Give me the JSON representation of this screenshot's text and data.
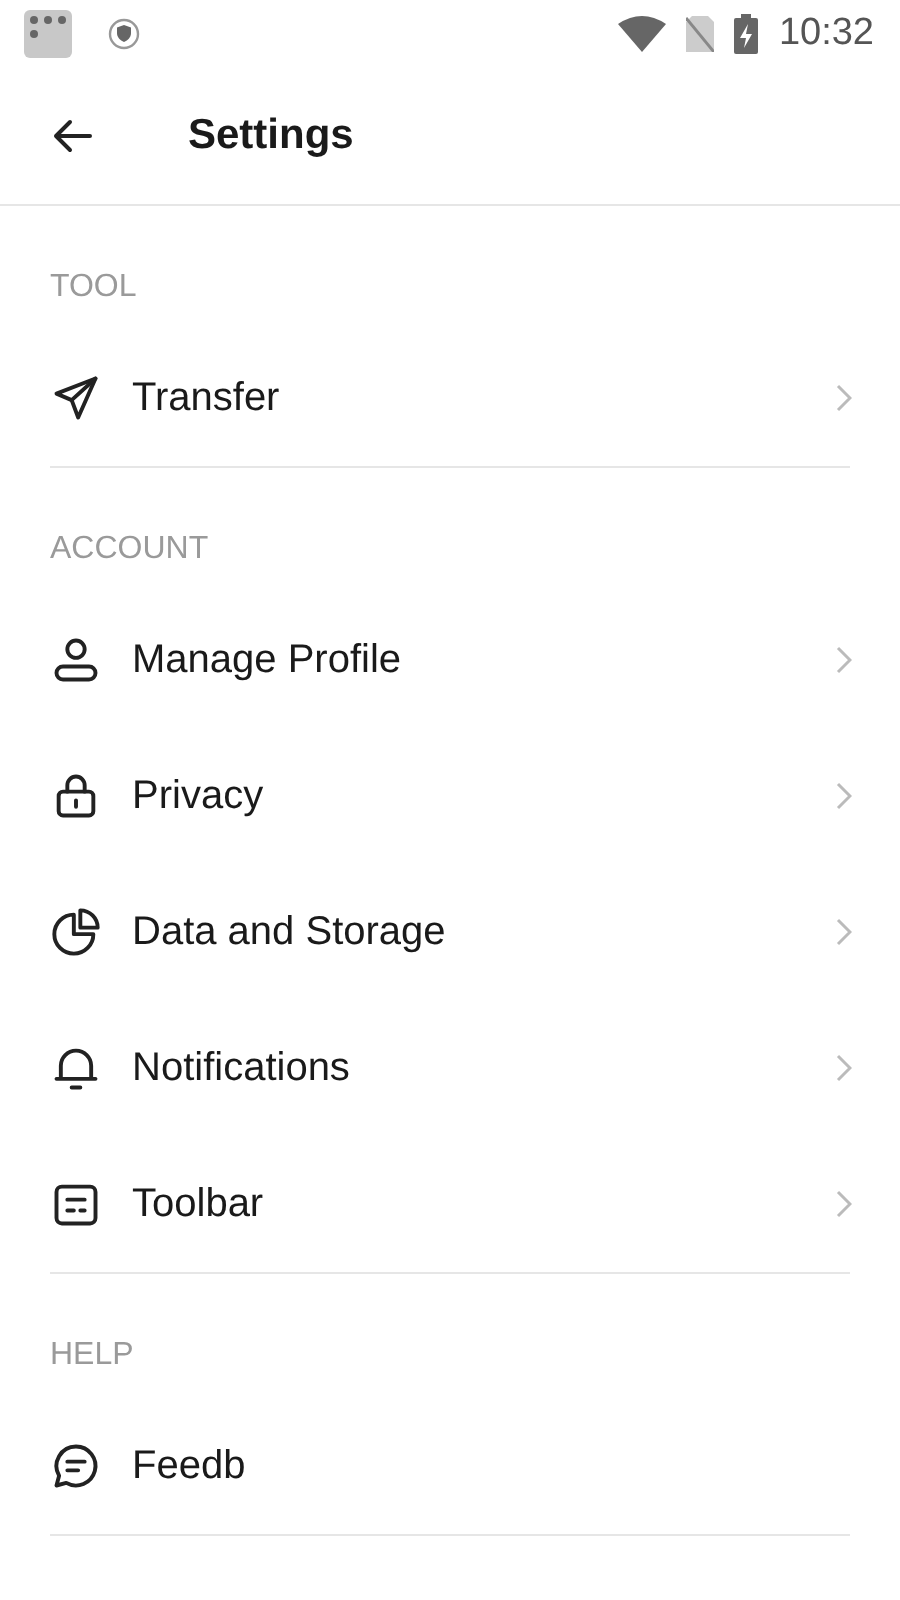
{
  "status_bar": {
    "time": "10:32"
  },
  "header": {
    "title": "Settings"
  },
  "sections": [
    {
      "title": "TOOL",
      "items": [
        {
          "label": "Transfer",
          "chevron": true
        }
      ]
    },
    {
      "title": "ACCOUNT",
      "items": [
        {
          "label": "Manage Profile",
          "chevron": true
        },
        {
          "label": "Privacy",
          "chevron": true
        },
        {
          "label": "Data and Storage",
          "chevron": true
        },
        {
          "label": "Notifications",
          "chevron": true
        },
        {
          "label": "Toolbar",
          "chevron": true
        }
      ]
    },
    {
      "title": "HELP",
      "items": [
        {
          "label": "Feedb",
          "chevron": false
        }
      ]
    }
  ]
}
